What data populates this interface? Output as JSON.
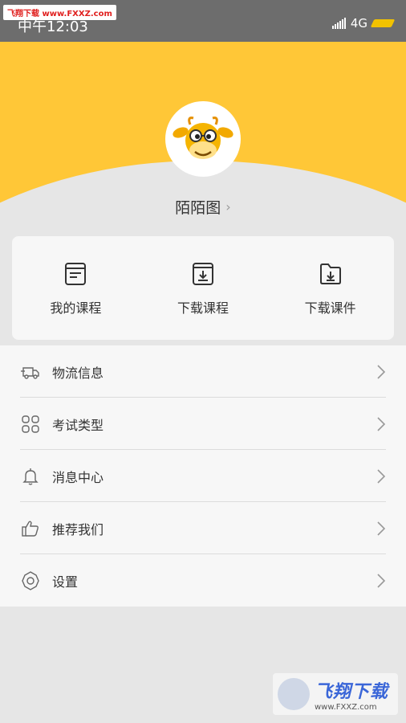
{
  "status_bar": {
    "time": "中午12:03",
    "network": "4G",
    "watermark": "飞翔下载 www.FXXZ.com"
  },
  "profile": {
    "username": "陌陌图",
    "chevron": "›"
  },
  "quick_actions": [
    {
      "label": "我的课程",
      "icon": "course-book-icon"
    },
    {
      "label": "下载课程",
      "icon": "download-box-icon"
    },
    {
      "label": "下载课件",
      "icon": "download-folder-icon"
    }
  ],
  "menu": [
    {
      "label": "物流信息",
      "icon": "delivery-truck-icon"
    },
    {
      "label": "考试类型",
      "icon": "grid-icon"
    },
    {
      "label": "消息中心",
      "icon": "bell-icon"
    },
    {
      "label": "推荐我们",
      "icon": "thumbs-up-icon"
    },
    {
      "label": "设置",
      "icon": "gear-icon"
    }
  ],
  "bottom_watermark": {
    "title": "飞翔下载",
    "url": "www.FXXZ.com"
  },
  "colors": {
    "header_yellow": "#ffc737",
    "background": "#e6e6e6",
    "card": "#f7f7f7",
    "status_bar": "#6d6d6d"
  }
}
